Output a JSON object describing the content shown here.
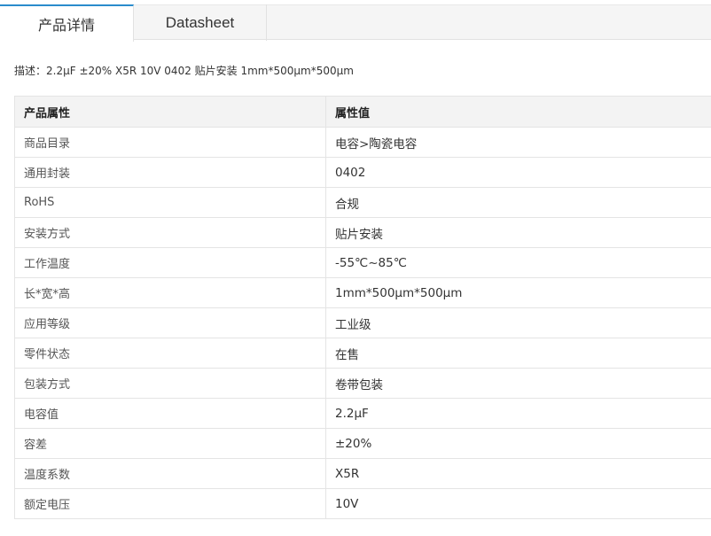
{
  "tabs": {
    "details": "产品详情",
    "datasheet": "Datasheet"
  },
  "description": {
    "label": "描述：",
    "text": "2.2μF ±20% X5R 10V 0402 贴片安装 1mm*500μm*500μm"
  },
  "table": {
    "headers": [
      "产品属性",
      "属性值"
    ],
    "rows": [
      [
        "商品目录",
        "电容>陶瓷电容"
      ],
      [
        "通用封装",
        "0402"
      ],
      [
        "RoHS",
        "合规"
      ],
      [
        "安装方式",
        "贴片安装"
      ],
      [
        "工作温度",
        "-55℃~85℃"
      ],
      [
        "长*宽*高",
        "1mm*500μm*500μm"
      ],
      [
        "应用等级",
        "工业级"
      ],
      [
        "零件状态",
        "在售"
      ],
      [
        "包装方式",
        "卷带包装"
      ],
      [
        "电容值",
        "2.2μF"
      ],
      [
        "容差",
        "±20%"
      ],
      [
        "温度系数",
        "X5R"
      ],
      [
        "额定电压",
        "10V"
      ]
    ]
  },
  "colors": {
    "active_tab_border": "#2a8ccc",
    "header_bg": "#f3f3f3",
    "border": "#e4e4e4"
  }
}
